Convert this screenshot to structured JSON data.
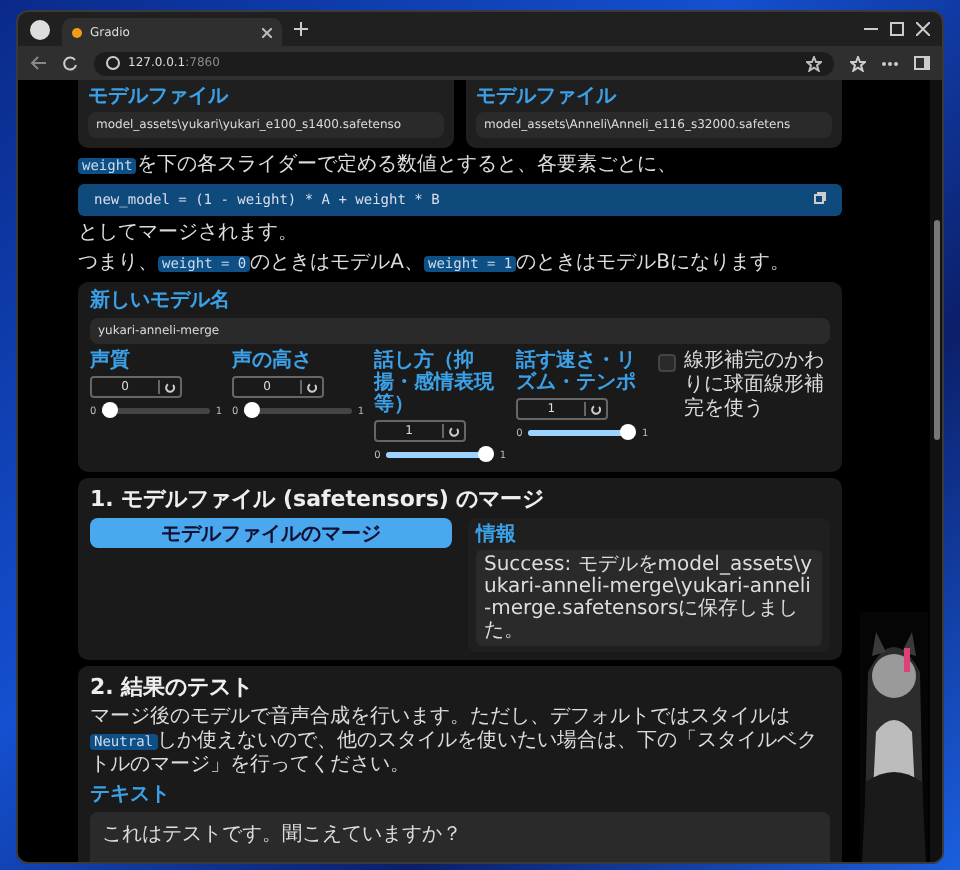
{
  "browser": {
    "tab_title": "Gradio",
    "url_host": "127.0.0.1",
    "url_port": ":7860"
  },
  "model_files": [
    {
      "label": "モデルファイル",
      "value": "model_assets\\yukari\\yukari_e100_s1400.safetenso"
    },
    {
      "label": "モデルファイル",
      "value": "model_assets\\Anneli\\Anneli_e116_s32000.safetens"
    }
  ],
  "weight_intro": [
    {
      "kind": "code",
      "text": "weight"
    },
    {
      "kind": "text",
      "text": "を下の各スライダーで定める数値とすると、各要素ごとに、"
    }
  ],
  "code_block": "new_model = (1 - weight) * A + weight * B",
  "merge_note": [
    {
      "kind": "text",
      "text": "としてマージされます。"
    }
  ],
  "summary": [
    {
      "kind": "text",
      "text": "つまり、"
    },
    {
      "kind": "code",
      "text": "weight = 0"
    },
    {
      "kind": "text",
      "text": "のときはモデルA、"
    },
    {
      "kind": "code",
      "text": "weight = 1"
    },
    {
      "kind": "text",
      "text": "のときはモデルBになります。"
    }
  ],
  "new_model_name": {
    "label": "新しいモデル名",
    "value": "yukari-anneli-merge"
  },
  "sliders": [
    {
      "label": "声質",
      "value": "0",
      "level": 0,
      "min": "0",
      "max": "1"
    },
    {
      "label": "声の高さ",
      "value": "0",
      "level": 0,
      "min": "0",
      "max": "1"
    },
    {
      "label": "話し方（抑揚・感情表現等）",
      "value": "1",
      "level": 1,
      "min": "0",
      "max": "1"
    },
    {
      "label": "話す速さ・リズム・テンポ",
      "value": "1",
      "level": 1,
      "min": "0",
      "max": "1"
    }
  ],
  "slerp_option": {
    "label": "線形補完のかわりに球面線形補完を使う",
    "checked": false
  },
  "section1": {
    "title": "1. モデルファイル (safetensors) のマージ",
    "button": "モデルファイルのマージ",
    "info_label": "情報",
    "info_text": "Success: モデルをmodel_assets\\yukari-anneli-merge\\yukari-anneli-merge.safetensorsに保存しました。"
  },
  "section2": {
    "title": "2. 結果のテスト",
    "description": [
      {
        "kind": "text",
        "text": "マージ後のモデルで音声合成を行います。ただし、デフォルトではスタイルは"
      },
      {
        "kind": "code",
        "text": "Neutral"
      },
      {
        "kind": "text",
        "text": "しか使えないので、他のスタイルを使いたい場合は、下の「スタイルベクトルのマージ」を行ってください。"
      }
    ],
    "text_label": "テキスト",
    "text_value": "これはテストです。聞こえていますか？"
  }
}
